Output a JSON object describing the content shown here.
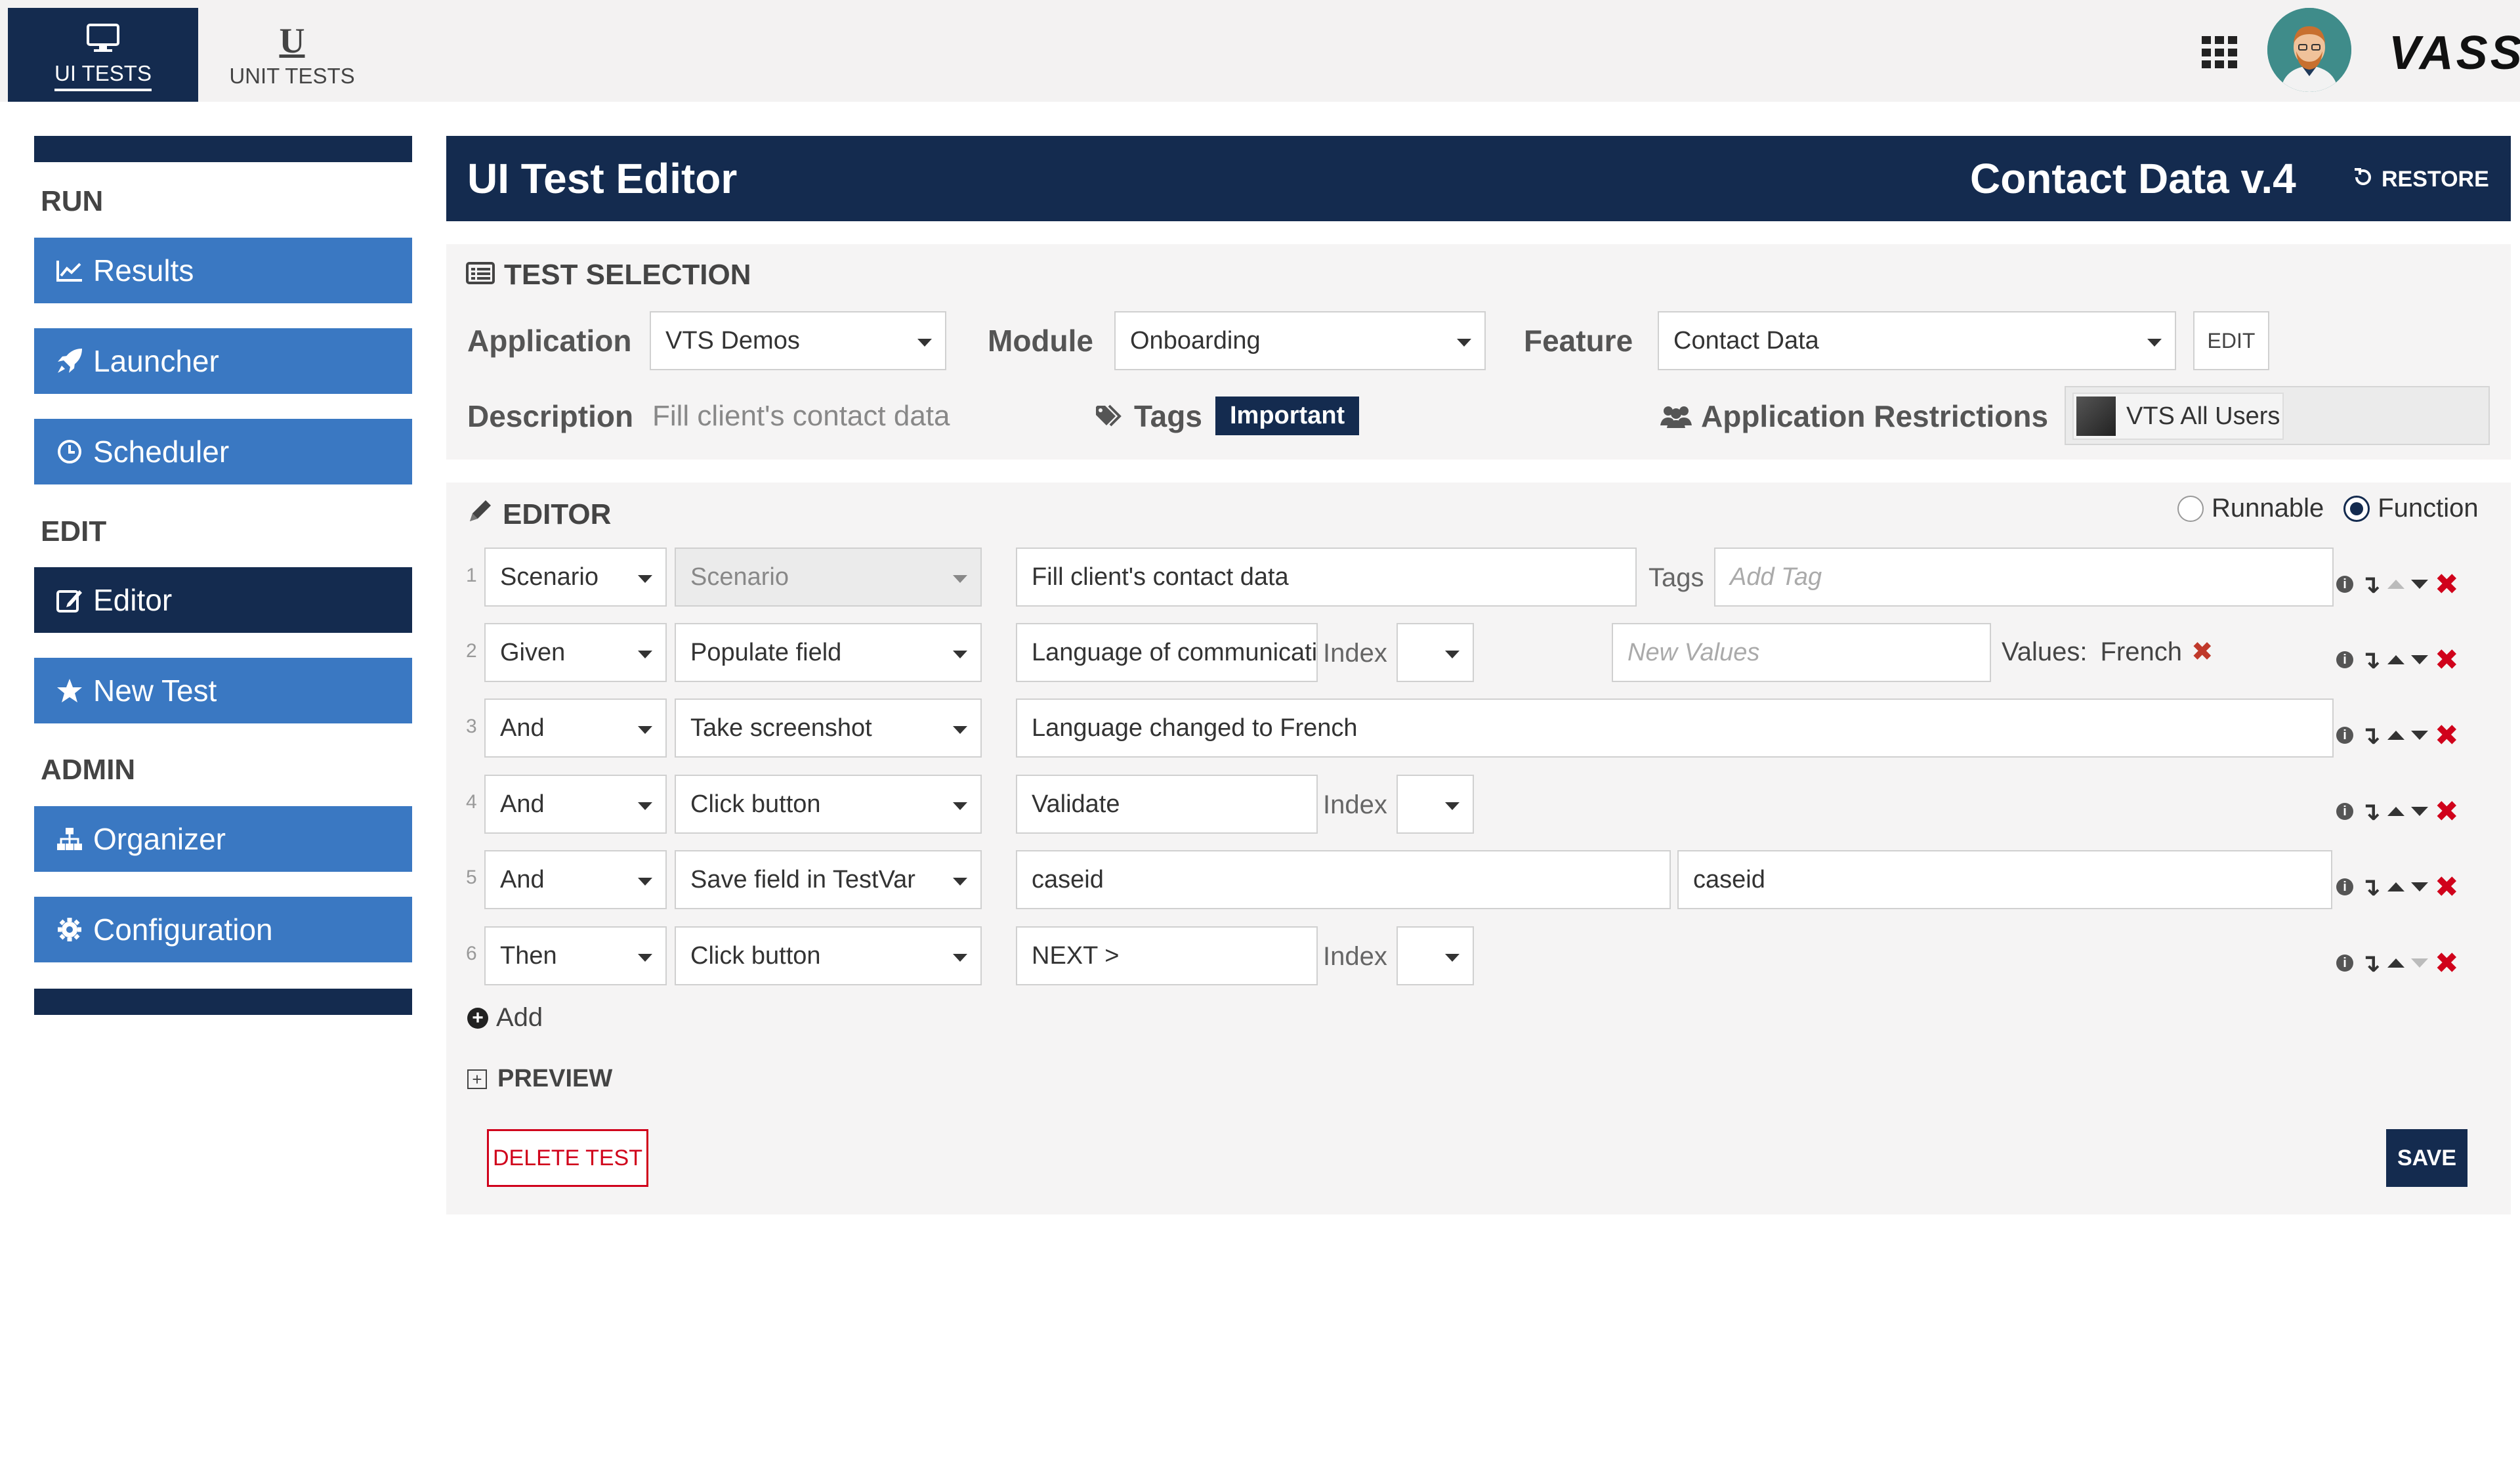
{
  "topbar": {
    "tabs": [
      {
        "label": "UI TESTS",
        "icon": "monitor-icon"
      },
      {
        "label": "UNIT TESTS",
        "icon": "u-icon"
      }
    ],
    "brand": "VASS"
  },
  "sidebar": {
    "sections": [
      {
        "title": "RUN",
        "items": [
          {
            "label": "Results",
            "icon": "chart-line-icon"
          },
          {
            "label": "Launcher",
            "icon": "rocket-icon"
          },
          {
            "label": "Scheduler",
            "icon": "clock-icon"
          }
        ]
      },
      {
        "title": "EDIT",
        "items": [
          {
            "label": "Editor",
            "icon": "edit-icon",
            "active": true
          },
          {
            "label": "New Test",
            "icon": "star-icon"
          }
        ]
      },
      {
        "title": "ADMIN",
        "items": [
          {
            "label": "Organizer",
            "icon": "sitemap-icon"
          },
          {
            "label": "Configuration",
            "icon": "gear-icon"
          }
        ]
      }
    ]
  },
  "header": {
    "title": "UI Test Editor",
    "test_name": "Contact Data v.4",
    "restore_label": "RESTORE"
  },
  "selection": {
    "title": "TEST SELECTION",
    "application_label": "Application",
    "application_value": "VTS Demos",
    "module_label": "Module",
    "module_value": "Onboarding",
    "feature_label": "Feature",
    "feature_value": "Contact Data",
    "edit_label": "EDIT",
    "description_label": "Description",
    "description_value": "Fill client's contact data",
    "tags_label": "Tags",
    "tag_value": "Important",
    "restrictions_label": "Application Restrictions",
    "restriction_value": "VTS All Users"
  },
  "editor": {
    "title": "EDITOR",
    "mode_options": [
      "Runnable",
      "Function"
    ],
    "mode_selected": "Function",
    "tags_label": "Tags",
    "tags_placeholder": "Add Tag",
    "index_label": "Index",
    "new_values_placeholder": "New Values",
    "values_label": "Values:",
    "values_item": "French",
    "rows": [
      {
        "num": "1",
        "keyword": "Scenario",
        "action": "Scenario",
        "text": "Fill client's contact data"
      },
      {
        "num": "2",
        "keyword": "Given",
        "action": "Populate field",
        "text": "Language of communication"
      },
      {
        "num": "3",
        "keyword": "And",
        "action": "Take screenshot",
        "text": "Language changed to French"
      },
      {
        "num": "4",
        "keyword": "And",
        "action": "Click button",
        "text": "Validate"
      },
      {
        "num": "5",
        "keyword": "And",
        "action": "Save field in TestVar",
        "text": "caseid",
        "text2": "caseid"
      },
      {
        "num": "6",
        "keyword": "Then",
        "action": "Click button",
        "text": "NEXT >"
      }
    ],
    "add_label": "Add",
    "preview_label": "PREVIEW",
    "delete_label": "DELETE TEST",
    "save_label": "SAVE"
  },
  "colors": {
    "navy": "#142b4f",
    "blue": "#3a78c2",
    "danger": "#d0021b"
  }
}
